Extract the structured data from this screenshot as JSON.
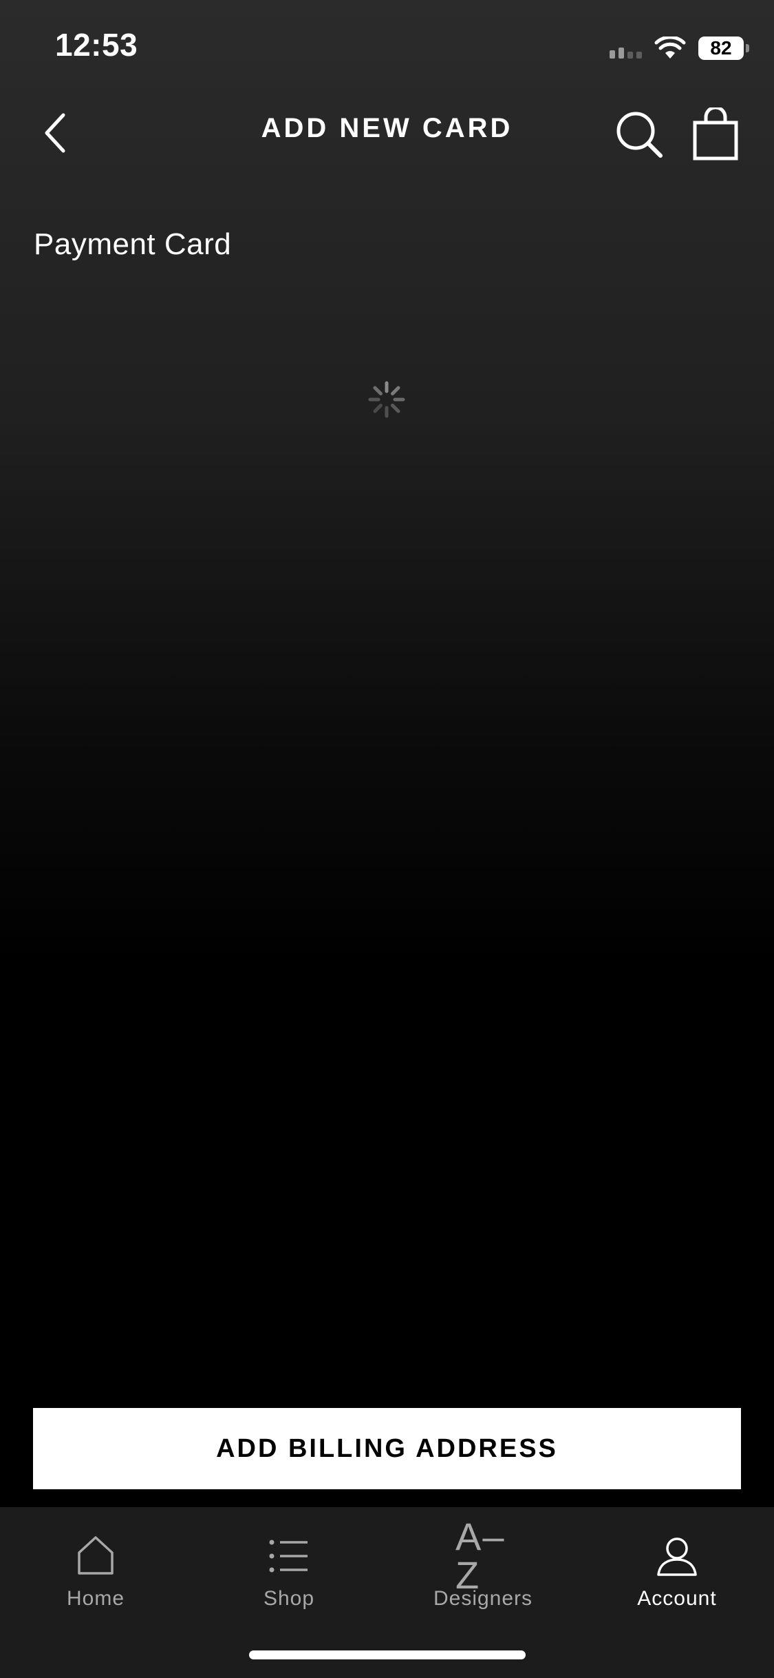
{
  "status_bar": {
    "time": "12:53",
    "battery": "82",
    "icons": [
      "cellular-signal-icon",
      "wifi-icon",
      "battery-icon"
    ]
  },
  "header": {
    "title": "ADD NEW CARD",
    "icons": [
      "chevron-left-icon",
      "search-icon",
      "shopping-bag-icon"
    ]
  },
  "content": {
    "section_title": "Payment Card",
    "loading_indicator": "spinner-icon"
  },
  "cta": {
    "label": "ADD BILLING ADDRESS"
  },
  "tabs": [
    {
      "label": "Home",
      "icon": "home-icon",
      "active": false
    },
    {
      "label": "Shop",
      "icon": "list-icon",
      "active": false
    },
    {
      "label": "Designers",
      "icon": "a-z-icon",
      "glyph": "A–Z",
      "active": false
    },
    {
      "label": "Account",
      "icon": "user-icon",
      "active": true
    }
  ],
  "colors": {
    "background_top": "#2b2b2b",
    "background_bottom": "#000000",
    "tabbar": "#1c1c1c",
    "cta_background": "#ffffff",
    "cta_text": "#000000",
    "inactive_tab": "#a8a8a8",
    "active_tab": "#ffffff"
  }
}
